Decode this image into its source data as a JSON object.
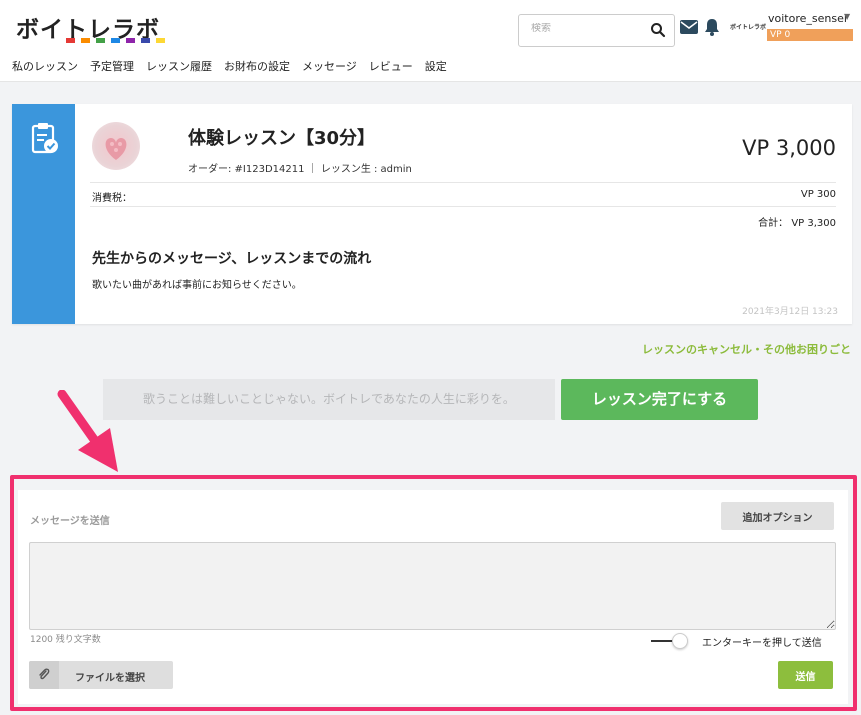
{
  "header": {
    "logo_text": "ボイトレラボ",
    "logo_dot_colors": [
      "#e53935",
      "#fb8c00",
      "#43a047",
      "#1e88e5",
      "#8e24aa",
      "#3949ab",
      "#fdd835"
    ],
    "search_placeholder": "検索",
    "mini_logo_text": "ボイトレラボ",
    "username": "voitore_sensei",
    "vp_balance": "VP 0",
    "nav": [
      "私のレッスン",
      "予定管理",
      "レッスン履歴",
      "お財布の設定",
      "メッセージ",
      "レビュー",
      "設定"
    ]
  },
  "lesson": {
    "title": "体験レッスン【30分】",
    "order_info": "オーダー: #I123D14211 ｜ レッスン生 : admin",
    "price": "VP 3,000",
    "tax_label": "消費税：",
    "tax_value": "VP 300",
    "total": "合計： VP 3,300",
    "message_heading": "先生からのメッセージ、レッスンまでの流れ",
    "message_body": "歌いたい曲があれば事前にお知らせください。",
    "date": "2021年3月12日 13:23"
  },
  "help_link": "レッスンのキャンセル・その他お困りごと",
  "motto": "歌うことは難しいことじゃない。ボイトレであなたの人生に彩りを。",
  "complete_button": "レッスン完了にする",
  "message_panel": {
    "title": "メッセージを送信",
    "options_button": "追加オプション",
    "textarea_value": "",
    "char_count": "1200 残り文字数",
    "enter_toggle_label": "エンターキーを押して送信",
    "file_button": "ファイルを選択",
    "send_button": "送信"
  },
  "colors": {
    "accent_blue": "#3b96dc",
    "complete_green": "#5cb85c",
    "send_green": "#8dbe3d",
    "highlight_pink": "#f0306e",
    "vp_orange": "#f0a05a"
  },
  "icons": [
    "search-icon",
    "mail-icon",
    "bell-icon",
    "clipboard-check-icon",
    "paperclip-icon",
    "arrow-icon"
  ]
}
